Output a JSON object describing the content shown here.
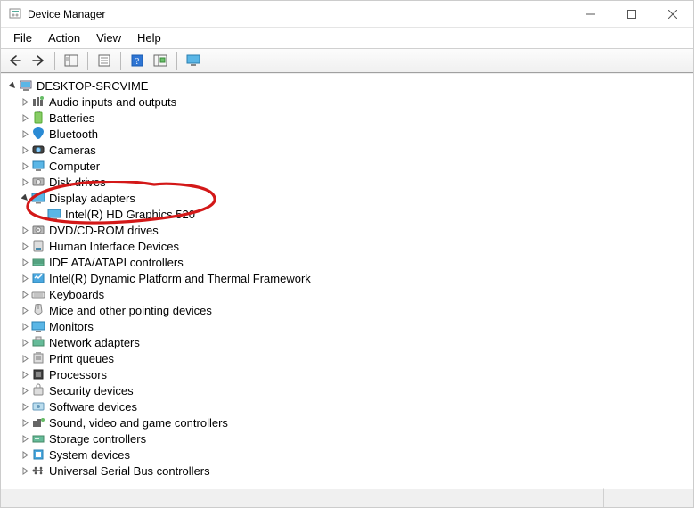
{
  "window": {
    "title": "Device Manager"
  },
  "menu": {
    "file": "File",
    "action": "Action",
    "view": "View",
    "help": "Help"
  },
  "tree": {
    "root": "DESKTOP-SRCVIME",
    "items": [
      {
        "label": "Audio inputs and outputs"
      },
      {
        "label": "Batteries"
      },
      {
        "label": "Bluetooth"
      },
      {
        "label": "Cameras"
      },
      {
        "label": "Computer"
      },
      {
        "label": "Disk drives"
      },
      {
        "label": "Display adapters",
        "expanded": true,
        "children": [
          {
            "label": "Intel(R) HD Graphics 520"
          }
        ]
      },
      {
        "label": "DVD/CD-ROM drives"
      },
      {
        "label": "Human Interface Devices"
      },
      {
        "label": "IDE ATA/ATAPI controllers"
      },
      {
        "label": "Intel(R) Dynamic Platform and Thermal Framework"
      },
      {
        "label": "Keyboards"
      },
      {
        "label": "Mice and other pointing devices"
      },
      {
        "label": "Monitors"
      },
      {
        "label": "Network adapters"
      },
      {
        "label": "Print queues"
      },
      {
        "label": "Processors"
      },
      {
        "label": "Security devices"
      },
      {
        "label": "Software devices"
      },
      {
        "label": "Sound, video and game controllers"
      },
      {
        "label": "Storage controllers"
      },
      {
        "label": "System devices"
      },
      {
        "label": "Universal Serial Bus controllers"
      }
    ]
  }
}
